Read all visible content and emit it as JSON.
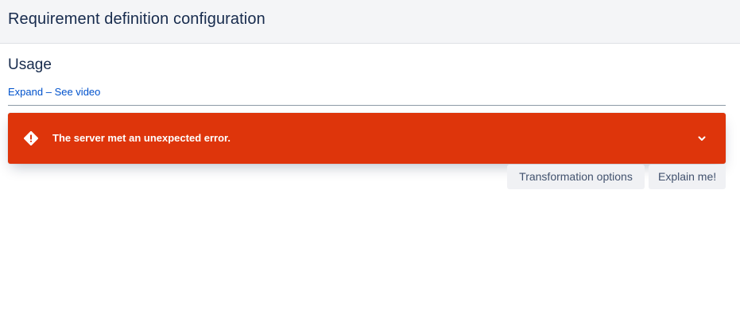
{
  "header": {
    "title": "Requirement definition configuration"
  },
  "usage": {
    "title": "Usage",
    "expand_label": "Expand",
    "separator": " – ",
    "video_label": "See video"
  },
  "error": {
    "message": "The server met an unexpected error.",
    "icon": "warning-icon",
    "toggle_icon": "chevron-down-icon",
    "color": "#de350b"
  },
  "actions": {
    "transformation_label": "Transformation options",
    "explain_label": "Explain me!"
  },
  "colors": {
    "link": "#0052cc",
    "header_bg": "#f4f5f7",
    "button_bg": "#f0f1f4"
  }
}
